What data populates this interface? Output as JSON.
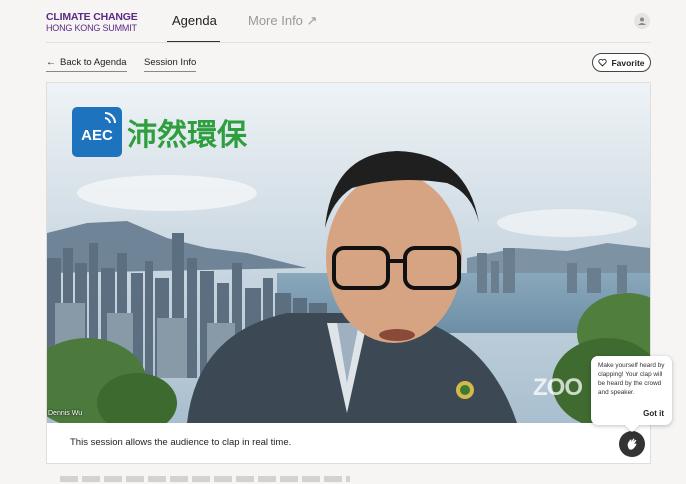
{
  "header": {
    "logo_line1": "CLIMATE CHANGE",
    "logo_line2": "HONG KONG SUMMIT",
    "tabs": [
      {
        "label": "Agenda"
      },
      {
        "label": "More Info ↗"
      }
    ]
  },
  "subnav": {
    "back_label": "Back to Agenda",
    "session_info_label": "Session Info",
    "favorite_label": "Favorite"
  },
  "video": {
    "brand_text": "沛然環保",
    "brand_badge": "AEC",
    "speaker_name": "Dennis Wu",
    "watermark": "ZOO"
  },
  "caption": {
    "text": "This session allows the audience to clap in real time."
  },
  "tooltip": {
    "text": "Make yourself heard by clapping! Your clap will be heard by the crowd and speaker.",
    "action_label": "Got it"
  },
  "colors": {
    "brand_purple": "#5b2a86",
    "aec_blue": "#1e73be",
    "brand_green": "#2e9e3e"
  },
  "icons": [
    "back-arrow-icon",
    "heart-icon",
    "clap-icon",
    "external-link-icon",
    "avatar-icon"
  ]
}
